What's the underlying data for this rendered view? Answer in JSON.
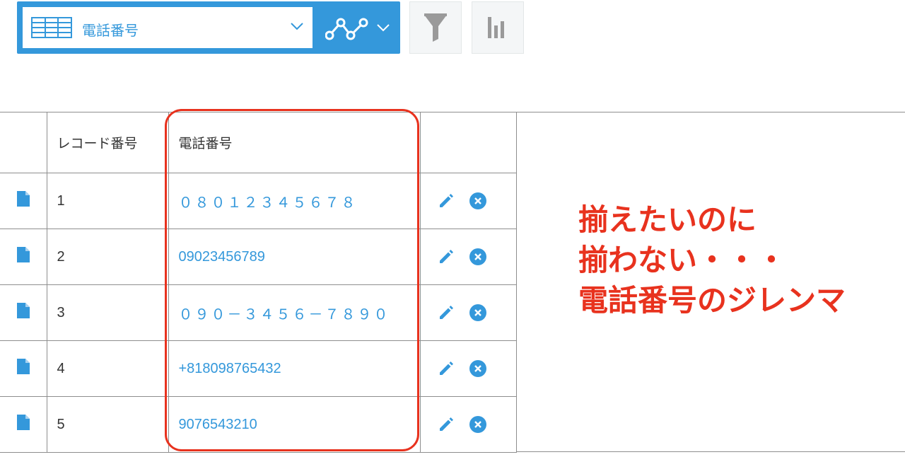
{
  "toolbar": {
    "view_name": "電話番号",
    "accent_color": "#3498db"
  },
  "table": {
    "headers": [
      "レコード番号",
      "電話番号"
    ],
    "rows": [
      {
        "record_no": "1",
        "phone": "０８０１２３４５６７８"
      },
      {
        "record_no": "2",
        "phone": "09023456789"
      },
      {
        "record_no": "3",
        "phone": "０９０－３４５６－７８９０"
      },
      {
        "record_no": "4",
        "phone": "+818098765432"
      },
      {
        "record_no": "5",
        "phone": "9076543210"
      }
    ]
  },
  "annotation": {
    "lines": [
      "揃えたいのに",
      "揃わない・・・",
      "電話番号のジレンマ"
    ],
    "color": "#e8321e"
  }
}
